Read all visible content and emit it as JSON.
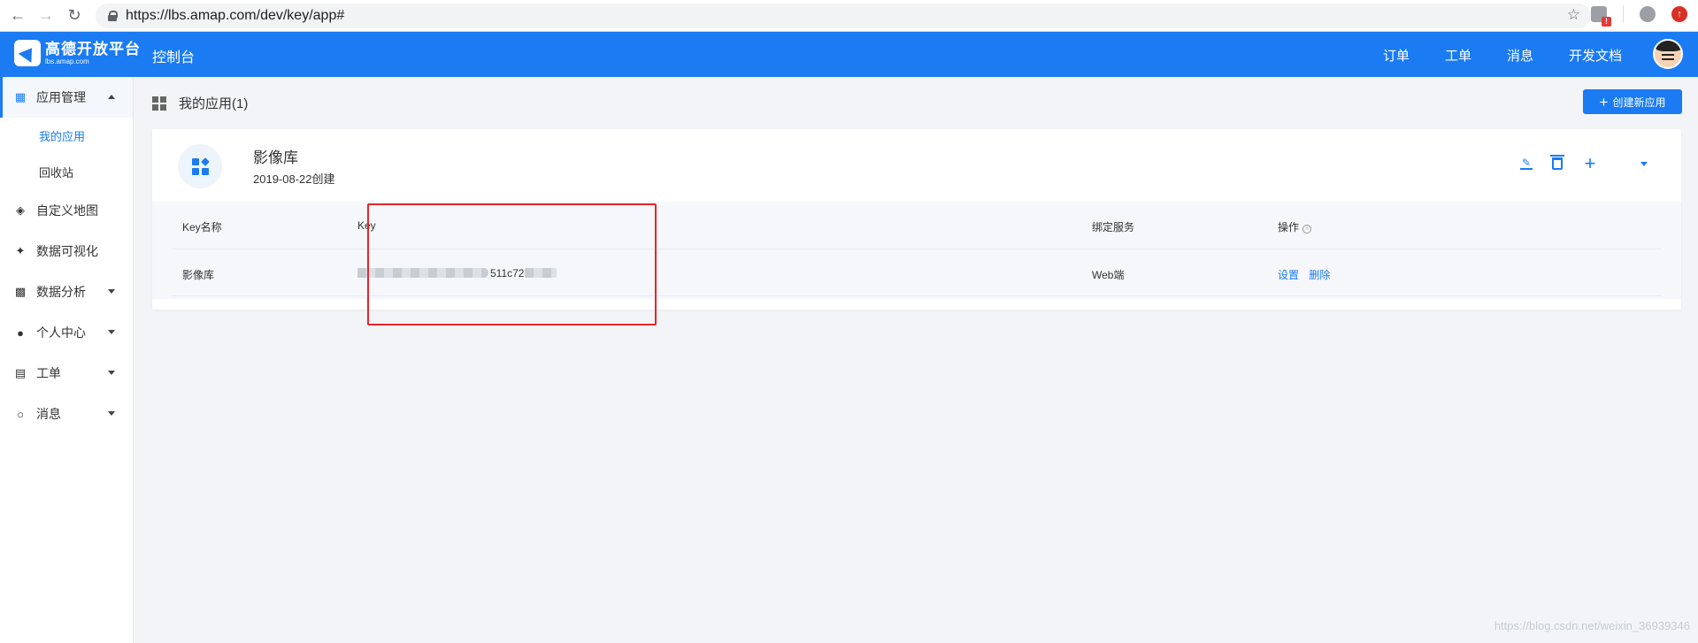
{
  "browser": {
    "url": "https://lbs.amap.com/dev/key/app#"
  },
  "header": {
    "logo_title": "高德开放平台",
    "logo_sub": "lbs.amap.com",
    "console": "控制台",
    "nav": [
      "订单",
      "工单",
      "消息",
      "开发文档"
    ]
  },
  "sidebar": {
    "items": [
      {
        "label": "应用管理",
        "icon": "apps-icon"
      },
      {
        "label": "自定义地图",
        "icon": "map-icon"
      },
      {
        "label": "数据可视化",
        "icon": "visualization-icon"
      },
      {
        "label": "数据分析",
        "icon": "bar-chart-icon"
      },
      {
        "label": "个人中心",
        "icon": "user-icon"
      },
      {
        "label": "工单",
        "icon": "clipboard-icon"
      },
      {
        "label": "消息",
        "icon": "chat-icon"
      }
    ],
    "sub_items": [
      "我的应用",
      "回收站"
    ]
  },
  "main": {
    "page_title": "我的应用(1)",
    "create_button": "创建新应用",
    "app": {
      "name": "影像库",
      "created": "2019-08-22创建"
    },
    "table": {
      "headers": [
        "Key名称",
        "Key",
        "绑定服务",
        "操作"
      ],
      "row": {
        "key_name": "影像库",
        "key_visible": "511c72",
        "service": "Web端",
        "actions": [
          "设置",
          "删除"
        ]
      }
    }
  },
  "watermark": "https://blog.csdn.net/weixin_36939346",
  "colors": {
    "brand": "#1a7bf2",
    "highlight": "#e5262a"
  }
}
